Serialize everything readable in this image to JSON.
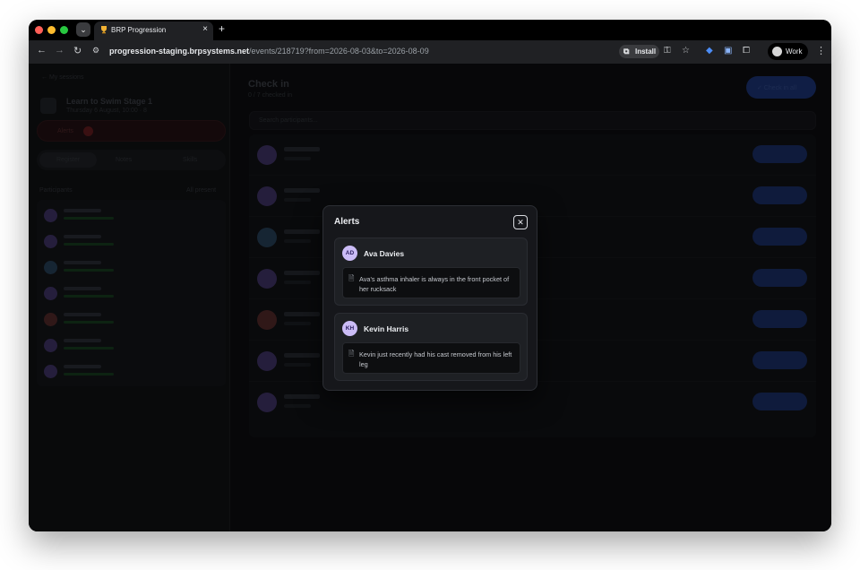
{
  "browser": {
    "tab_title": "BRP Progression",
    "tab_close_icon": "close-icon",
    "new_tab_label": "+",
    "url_host": "progression-staging.brpsystems.net",
    "url_path": "/events/218719?from=2026-08-03&to=2026-08-09",
    "install_label": "Install",
    "profile_label": "Work"
  },
  "modal": {
    "title": "Alerts",
    "close_glyph": "✕",
    "alerts": [
      {
        "initials": "AD",
        "name": "Ava Davies",
        "note": "Ava's asthma inhaler is always in the front pocket of her rucksack"
      },
      {
        "initials": "KH",
        "name": "Kevin Harris",
        "note": "Kevin just recently had his cast removed from his left leg"
      }
    ]
  },
  "background": {
    "back_link": "← My sessions",
    "session_title": "Learn to Swim Stage 1",
    "session_subtitle": "Thursday 6 August, 10:00 · 8",
    "alerts_label": "Alerts",
    "segments": [
      "Register",
      "Notes",
      "Skills"
    ],
    "participants_label": "Participants",
    "participants_right": "All present",
    "participants": [
      "Ava Davies",
      "Evelyn Brady",
      "James White",
      "Kevin Harris",
      "Paul Moore",
      "Robert Fowler",
      "Thomas MacDonald"
    ],
    "main_title": "Check in",
    "main_subtitle": "0 / 7 checked in",
    "check_all_label": "✓ Check in all",
    "search_placeholder": "Search participants...",
    "row_button_label": "✓ Check in"
  },
  "colors": {
    "accent": "#1a2f6a",
    "avatar_bg": "#cbbcf6",
    "alert_red": "#5a1a1c"
  }
}
